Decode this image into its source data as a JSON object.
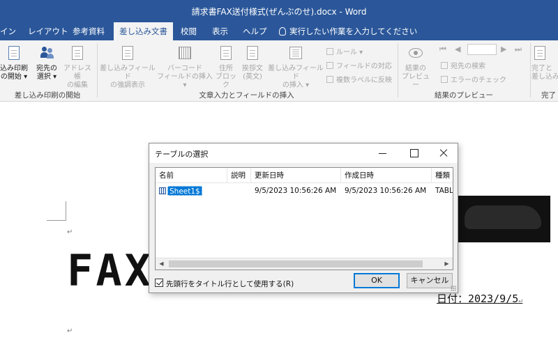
{
  "window": {
    "title": "請求書FAX送付様式(ぜんぶのせ).docx  -  Word"
  },
  "tabs": [
    {
      "label": "イン",
      "active": false
    },
    {
      "label": "レイアウト",
      "active": false
    },
    {
      "label": "参考資料",
      "active": false
    },
    {
      "label": "差し込み文書",
      "active": true
    },
    {
      "label": "校閲",
      "active": false
    },
    {
      "label": "表示",
      "active": false
    },
    {
      "label": "ヘルプ",
      "active": false
    }
  ],
  "tell_me": "実行したい作業を入力してください",
  "ribbon": {
    "start_group": {
      "label": "差し込み印刷の開始",
      "buttons": [
        {
          "line1": "込み印刷",
          "line2": "の開始 ▾"
        },
        {
          "line1": "宛先の",
          "line2": "選択 ▾"
        },
        {
          "line1": "アドレス帳",
          "line2": "の編集"
        }
      ]
    },
    "write_group": {
      "label": "文章入力とフィールドの挿入",
      "buttons": [
        {
          "line1": "差し込みフィールド",
          "line2": "の強調表示"
        },
        {
          "line1": "バーコード",
          "line2": "フィールドの挿入 ▾"
        },
        {
          "line1": "住所",
          "line2": "ブロック"
        },
        {
          "line1": "挨拶文",
          "line2": "(英文)"
        },
        {
          "line1": "差し込みフィールド",
          "line2": "の挿入 ▾"
        }
      ],
      "small": [
        "ルール ▾",
        "フィールドの対応",
        "複数ラベルに反映"
      ]
    },
    "preview_group": {
      "label": "結果のプレビュー",
      "preview_button": {
        "line1": "結果の",
        "line2": "プレビュー"
      },
      "small": [
        "宛先の検索",
        "エラーのチェック"
      ],
      "nav": [
        "⏮",
        "◀",
        "▶",
        "⏭"
      ]
    },
    "finish_group": {
      "label": "完了",
      "button": {
        "line1": "完了と",
        "line2": "差し込み"
      }
    }
  },
  "document": {
    "heading": "FAX",
    "date_line": "日付：2023/9/5",
    "para_mark": "↵"
  },
  "dialog": {
    "title": "テーブルの選択",
    "columns": [
      "名前",
      "説明",
      "更新日時",
      "作成日時",
      "種類"
    ],
    "rows": [
      {
        "name": "Sheet1$",
        "description": "",
        "modified": "9/5/2023 10:56:26 AM",
        "created": "9/5/2023 10:56:26 AM",
        "type": "TABLE"
      }
    ],
    "checkbox_label": "先頭行をタイトル行として使用する(R)",
    "checkbox_checked": true,
    "ok_label": "OK",
    "cancel_label": "キャンセル"
  }
}
